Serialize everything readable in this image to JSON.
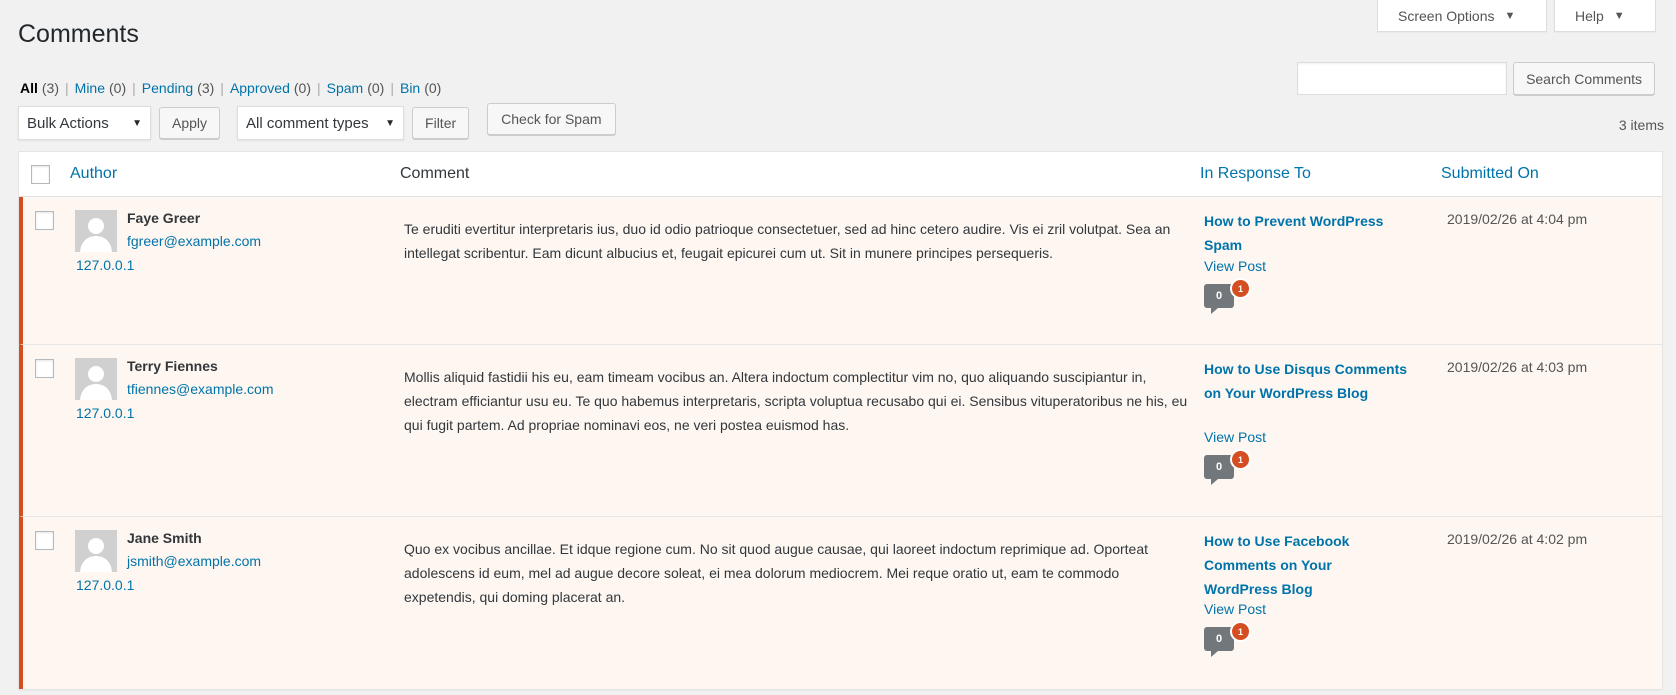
{
  "screen_meta": {
    "screen_options_label": "Screen Options",
    "help_label": "Help",
    "caret": "▼"
  },
  "page_title": "Comments",
  "status_links": [
    {
      "label": "All",
      "count": "(3)",
      "current": true
    },
    {
      "label": "Mine",
      "count": "(0)"
    },
    {
      "label": "Pending",
      "count": "(3)"
    },
    {
      "label": "Approved",
      "count": "(0)"
    },
    {
      "label": "Spam",
      "count": "(0)"
    },
    {
      "label": "Bin",
      "count": "(0)"
    }
  ],
  "search": {
    "value": "",
    "button_label": "Search Comments"
  },
  "tablenav": {
    "bulk_actions": "Bulk Actions",
    "apply_label": "Apply",
    "comment_types": "All comment types",
    "filter_label": "Filter",
    "check_spam_label": "Check for Spam",
    "items_count": "3 items"
  },
  "columns": {
    "author": "Author",
    "comment": "Comment",
    "response": "In Response To",
    "submitted": "Submitted On"
  },
  "comments": [
    {
      "author": "Faye Greer",
      "email": "fgreer@example.com",
      "ip": "127.0.0.1",
      "text": "Te eruditi evertitur interpretaris ius, duo id odio patrioque consectetuer, sed ad hinc cetero audire. Vis ei zril volutpat. Sea an intellegat scribentur. Eam dicunt albucius et, feugait epicurei cum ut. Sit in munere principes persequeris.",
      "post_title": "How to Prevent WordPress Spam",
      "view_post": "View Post",
      "approved_count": "0",
      "pending_count": "1",
      "submitted": "2019/02/26 at 4:04 pm"
    },
    {
      "author": "Terry Fiennes",
      "email": "tfiennes@example.com",
      "ip": "127.0.0.1",
      "text": "Mollis aliquid fastidii his eu, eam timeam vocibus an. Altera indoctum complectitur vim no, quo aliquando suscipiantur in, electram efficiantur usu eu. Te quo habemus interpretaris, scripta voluptua recusabo qui ei. Sensibus vituperatoribus ne his, eu qui fugit partem. Ad propriae nominavi eos, ne veri postea euismod has.",
      "post_title": "How to Use Disqus Comments on Your WordPress Blog",
      "view_post": "View Post",
      "approved_count": "0",
      "pending_count": "1",
      "submitted": "2019/02/26 at 4:03 pm"
    },
    {
      "author": "Jane Smith",
      "email": "jsmith@example.com",
      "ip": "127.0.0.1",
      "text": "Quo ex vocibus ancillae. Et idque regione cum. No sit quod augue causae, qui laoreet indoctum reprimique ad. Oporteat adolescens id eum, mel ad augue decore soleat, ei mea dolorum mediocrem. Mei reque oratio ut, eam te commodo expetendis, qui doming placerat an.",
      "post_title": "How to Use Facebook Comments on Your WordPress Blog",
      "view_post": "View Post",
      "approved_count": "0",
      "pending_count": "1",
      "submitted": "2019/02/26 at 4:02 pm"
    }
  ],
  "colors": {
    "link": "#0073aa",
    "pending_border": "#d54e21",
    "pending_row_bg": "#fef7f1",
    "page_bg": "#f1f1f1"
  }
}
